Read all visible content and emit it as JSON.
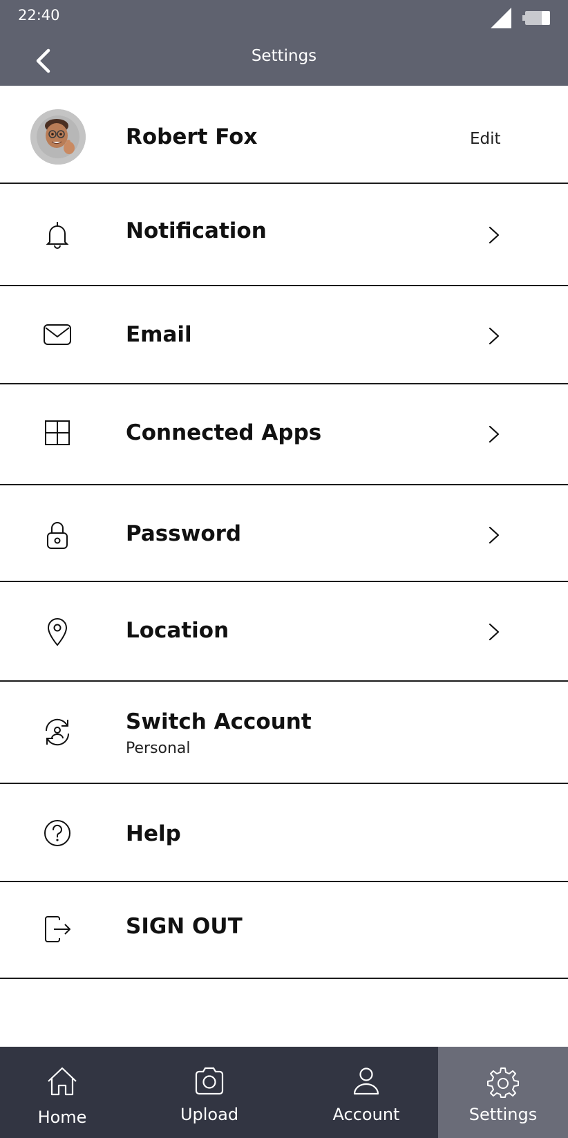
{
  "status_bar": {
    "time": "22:40"
  },
  "header": {
    "title": "Settings",
    "back_icon": "chevron-left-icon"
  },
  "profile": {
    "name": "Robert Fox",
    "edit_label": "Edit"
  },
  "menu": [
    {
      "label": "Notification",
      "icon": "bell-icon",
      "has_chevron": true
    },
    {
      "label": "Email",
      "icon": "mail-icon",
      "has_chevron": true
    },
    {
      "label": "Connected Apps",
      "icon": "grid-icon",
      "has_chevron": true
    },
    {
      "label": "Password",
      "icon": "lock-icon",
      "has_chevron": true
    },
    {
      "label": "Location",
      "icon": "location-pin-icon",
      "has_chevron": true
    },
    {
      "label": "Switch Account",
      "sublabel": "Personal",
      "icon": "switch-account-icon",
      "has_chevron": false
    },
    {
      "label": "Help",
      "icon": "help-icon",
      "has_chevron": false
    },
    {
      "label": "SIGN OUT",
      "icon": "sign-out-icon",
      "has_chevron": false
    }
  ],
  "tabs": [
    {
      "label": "Home",
      "icon": "home-icon",
      "active": false
    },
    {
      "label": "Upload",
      "icon": "camera-icon",
      "active": false
    },
    {
      "label": "Account",
      "icon": "user-icon",
      "active": false
    },
    {
      "label": "Settings",
      "icon": "gear-icon",
      "active": true
    }
  ],
  "colors": {
    "appbar": "#5f626f",
    "tabbar": "#323542",
    "tab_active": "#6a6c78",
    "divider": "#1b1b1b"
  }
}
